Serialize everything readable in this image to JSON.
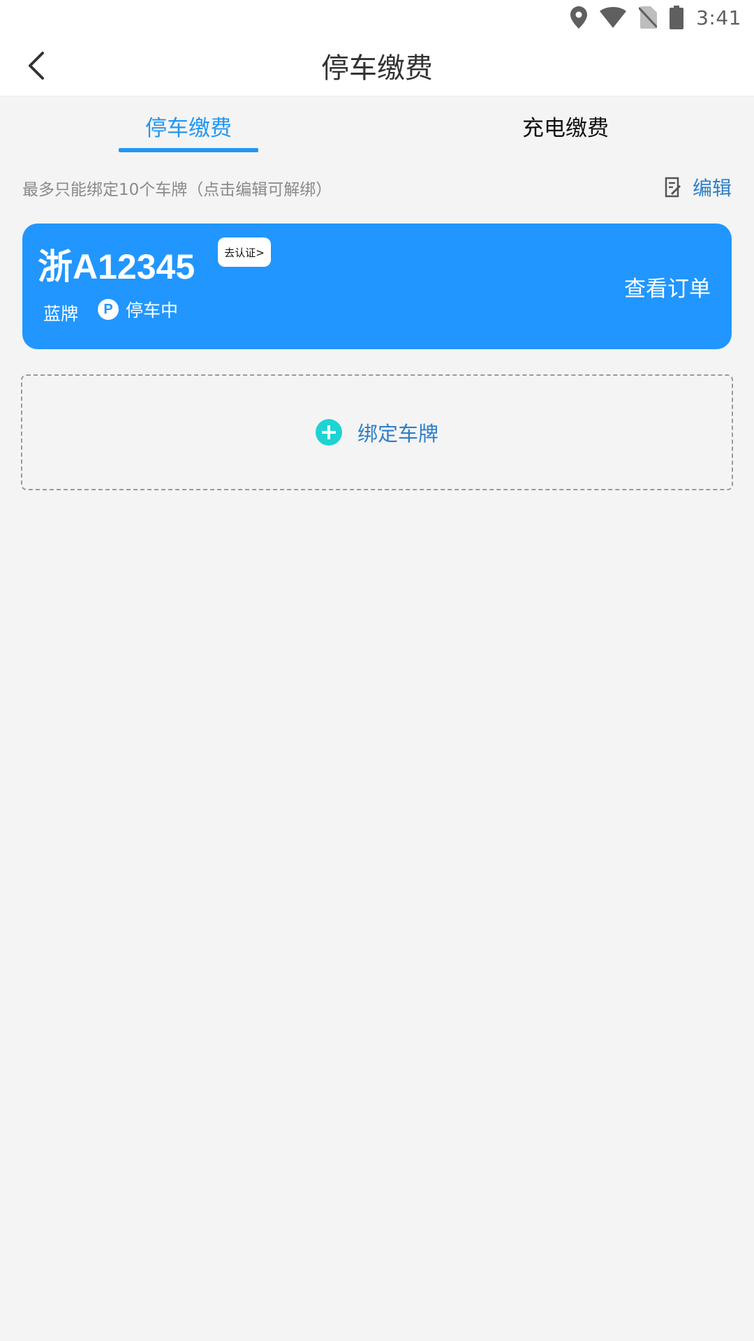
{
  "status_bar": {
    "time": "3:41",
    "icons": [
      "location-icon",
      "wifi-icon",
      "no-sim-icon",
      "battery-icon"
    ]
  },
  "app_bar": {
    "title": "停车缴费",
    "back_icon": "chevron-left-icon"
  },
  "tabs": [
    {
      "label": "停车缴费",
      "active": true
    },
    {
      "label": "充电缴费",
      "active": false
    }
  ],
  "hint": {
    "text": "最多只能绑定10个车牌（点击编辑可解绑）"
  },
  "edit": {
    "label": "编辑",
    "icon": "edit-note-icon"
  },
  "plates": [
    {
      "number": "浙A12345",
      "certify_label": "去认证>",
      "color_label": "蓝牌",
      "status_label": "停车中",
      "status_icon": "P",
      "view_orders_label": "查看订单"
    }
  ],
  "bind_plate": {
    "label": "绑定车牌",
    "icon": "plus-circle-icon"
  },
  "colors": {
    "accent": "#2196f3",
    "card_bg": "#2196ff",
    "plus_icon": "#1ed3d3",
    "link": "#2e7fc8",
    "page_bg": "#f4f4f4"
  }
}
